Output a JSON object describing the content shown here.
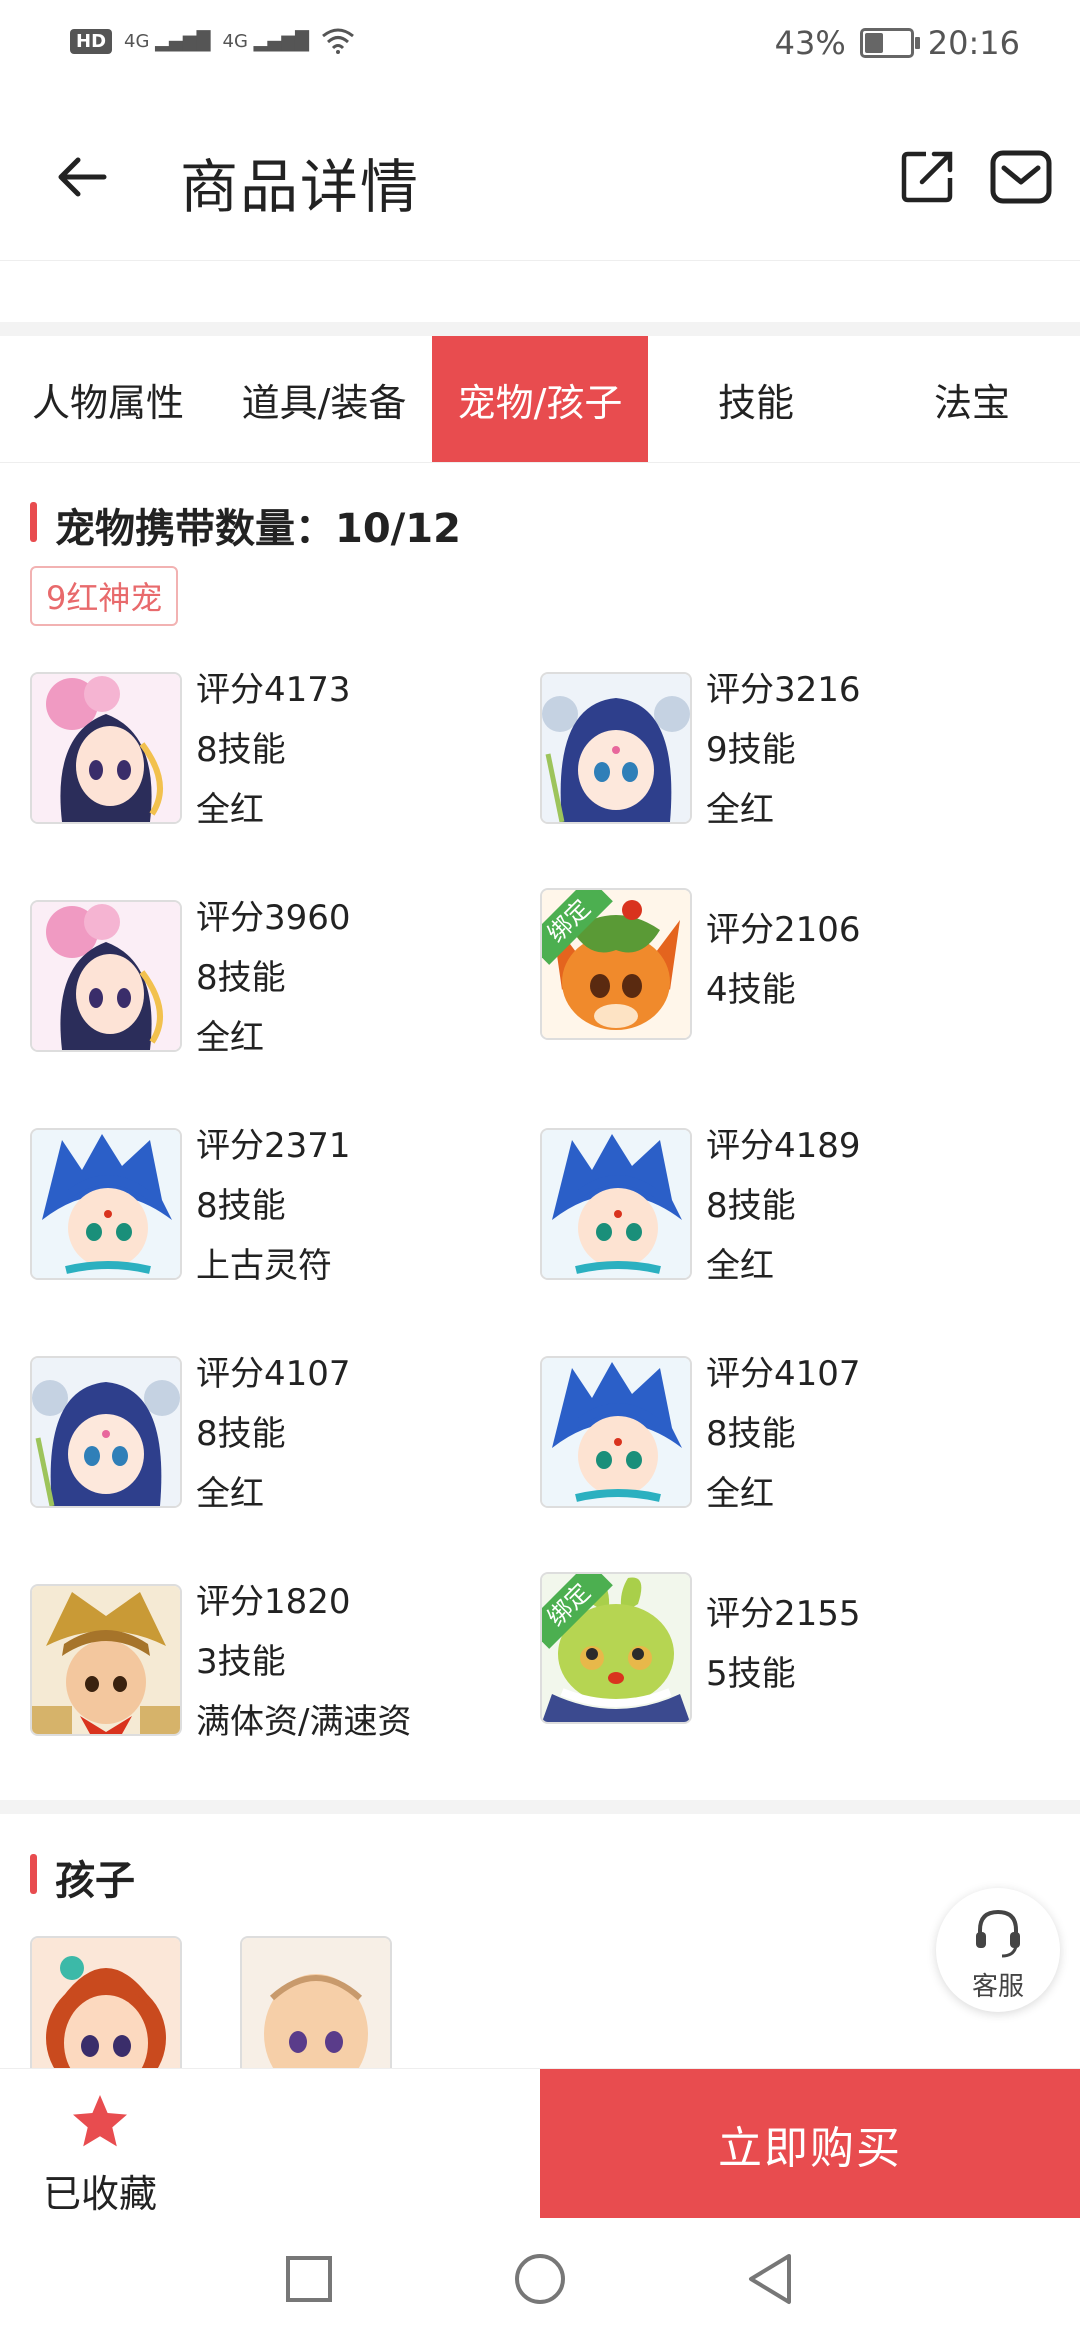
{
  "status_bar": {
    "hd": "HD",
    "net1": "4G",
    "net2": "4G",
    "battery": "43%",
    "time": "20:16",
    "battery_level": 0.43
  },
  "header": {
    "title": "商品详情"
  },
  "tabs": [
    {
      "label": "人物属性"
    },
    {
      "label": "道具/装备"
    },
    {
      "label": "宠物/孩子",
      "active": true
    },
    {
      "label": "技能"
    },
    {
      "label": "法宝"
    }
  ],
  "pets_section": {
    "title": "宠物携带数量：10/12",
    "tag": "9红神宠",
    "pets": [
      {
        "score": "评分4173",
        "skills": "8技能",
        "note": "全红",
        "bound": false,
        "avatar": "pink-lotus-girl"
      },
      {
        "score": "评分3216",
        "skills": "9技能",
        "note": "全红",
        "bound": false,
        "avatar": "blue-hair-girl"
      },
      {
        "score": "评分3960",
        "skills": "8技能",
        "note": "全红",
        "bound": false,
        "avatar": "pink-lotus-girl"
      },
      {
        "score": "评分2106",
        "skills": "4技能",
        "note": "",
        "bound": true,
        "bind_label": "绑定",
        "avatar": "orange-fox"
      },
      {
        "score": "评分2371",
        "skills": "8技能",
        "note": "上古灵符",
        "bound": false,
        "avatar": "blue-hair-boy"
      },
      {
        "score": "评分4189",
        "skills": "8技能",
        "note": "全红",
        "bound": false,
        "avatar": "blue-hair-boy"
      },
      {
        "score": "评分4107",
        "skills": "8技能",
        "note": "全红",
        "bound": false,
        "avatar": "blue-hair-girl"
      },
      {
        "score": "评分4107",
        "skills": "8技能",
        "note": "全红",
        "bound": false,
        "avatar": "blue-hair-boy"
      },
      {
        "score": "评分1820",
        "skills": "3技能",
        "note": "满体资/满速资",
        "bound": false,
        "avatar": "golden-warrior"
      },
      {
        "score": "评分2155",
        "skills": "5技能",
        "note": "",
        "bound": true,
        "bind_label": "绑定",
        "avatar": "green-bun"
      }
    ]
  },
  "kids_section": {
    "title": "孩子",
    "kids": [
      {
        "avatar": "red-hair-girl"
      },
      {
        "avatar": "bald-monk-boy"
      }
    ]
  },
  "service": {
    "label": "客服"
  },
  "bottom_bar": {
    "favorite_label": "已收藏",
    "buy_label": "立即购买"
  },
  "colors": {
    "accent": "#e84c4f",
    "bind_green": "#4caf50"
  }
}
